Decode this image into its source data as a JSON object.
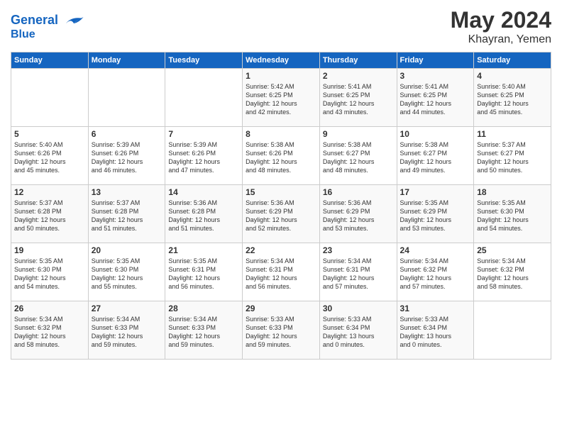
{
  "header": {
    "logo_line1": "General",
    "logo_line2": "Blue",
    "month": "May 2024",
    "location": "Khayran, Yemen"
  },
  "days_of_week": [
    "Sunday",
    "Monday",
    "Tuesday",
    "Wednesday",
    "Thursday",
    "Friday",
    "Saturday"
  ],
  "weeks": [
    [
      {
        "day": "",
        "info": ""
      },
      {
        "day": "",
        "info": ""
      },
      {
        "day": "",
        "info": ""
      },
      {
        "day": "1",
        "info": "Sunrise: 5:42 AM\nSunset: 6:25 PM\nDaylight: 12 hours\nand 42 minutes."
      },
      {
        "day": "2",
        "info": "Sunrise: 5:41 AM\nSunset: 6:25 PM\nDaylight: 12 hours\nand 43 minutes."
      },
      {
        "day": "3",
        "info": "Sunrise: 5:41 AM\nSunset: 6:25 PM\nDaylight: 12 hours\nand 44 minutes."
      },
      {
        "day": "4",
        "info": "Sunrise: 5:40 AM\nSunset: 6:25 PM\nDaylight: 12 hours\nand 45 minutes."
      }
    ],
    [
      {
        "day": "5",
        "info": "Sunrise: 5:40 AM\nSunset: 6:26 PM\nDaylight: 12 hours\nand 45 minutes."
      },
      {
        "day": "6",
        "info": "Sunrise: 5:39 AM\nSunset: 6:26 PM\nDaylight: 12 hours\nand 46 minutes."
      },
      {
        "day": "7",
        "info": "Sunrise: 5:39 AM\nSunset: 6:26 PM\nDaylight: 12 hours\nand 47 minutes."
      },
      {
        "day": "8",
        "info": "Sunrise: 5:38 AM\nSunset: 6:26 PM\nDaylight: 12 hours\nand 48 minutes."
      },
      {
        "day": "9",
        "info": "Sunrise: 5:38 AM\nSunset: 6:27 PM\nDaylight: 12 hours\nand 48 minutes."
      },
      {
        "day": "10",
        "info": "Sunrise: 5:38 AM\nSunset: 6:27 PM\nDaylight: 12 hours\nand 49 minutes."
      },
      {
        "day": "11",
        "info": "Sunrise: 5:37 AM\nSunset: 6:27 PM\nDaylight: 12 hours\nand 50 minutes."
      }
    ],
    [
      {
        "day": "12",
        "info": "Sunrise: 5:37 AM\nSunset: 6:28 PM\nDaylight: 12 hours\nand 50 minutes."
      },
      {
        "day": "13",
        "info": "Sunrise: 5:37 AM\nSunset: 6:28 PM\nDaylight: 12 hours\nand 51 minutes."
      },
      {
        "day": "14",
        "info": "Sunrise: 5:36 AM\nSunset: 6:28 PM\nDaylight: 12 hours\nand 51 minutes."
      },
      {
        "day": "15",
        "info": "Sunrise: 5:36 AM\nSunset: 6:29 PM\nDaylight: 12 hours\nand 52 minutes."
      },
      {
        "day": "16",
        "info": "Sunrise: 5:36 AM\nSunset: 6:29 PM\nDaylight: 12 hours\nand 53 minutes."
      },
      {
        "day": "17",
        "info": "Sunrise: 5:35 AM\nSunset: 6:29 PM\nDaylight: 12 hours\nand 53 minutes."
      },
      {
        "day": "18",
        "info": "Sunrise: 5:35 AM\nSunset: 6:30 PM\nDaylight: 12 hours\nand 54 minutes."
      }
    ],
    [
      {
        "day": "19",
        "info": "Sunrise: 5:35 AM\nSunset: 6:30 PM\nDaylight: 12 hours\nand 54 minutes."
      },
      {
        "day": "20",
        "info": "Sunrise: 5:35 AM\nSunset: 6:30 PM\nDaylight: 12 hours\nand 55 minutes."
      },
      {
        "day": "21",
        "info": "Sunrise: 5:35 AM\nSunset: 6:31 PM\nDaylight: 12 hours\nand 56 minutes."
      },
      {
        "day": "22",
        "info": "Sunrise: 5:34 AM\nSunset: 6:31 PM\nDaylight: 12 hours\nand 56 minutes."
      },
      {
        "day": "23",
        "info": "Sunrise: 5:34 AM\nSunset: 6:31 PM\nDaylight: 12 hours\nand 57 minutes."
      },
      {
        "day": "24",
        "info": "Sunrise: 5:34 AM\nSunset: 6:32 PM\nDaylight: 12 hours\nand 57 minutes."
      },
      {
        "day": "25",
        "info": "Sunrise: 5:34 AM\nSunset: 6:32 PM\nDaylight: 12 hours\nand 58 minutes."
      }
    ],
    [
      {
        "day": "26",
        "info": "Sunrise: 5:34 AM\nSunset: 6:32 PM\nDaylight: 12 hours\nand 58 minutes."
      },
      {
        "day": "27",
        "info": "Sunrise: 5:34 AM\nSunset: 6:33 PM\nDaylight: 12 hours\nand 59 minutes."
      },
      {
        "day": "28",
        "info": "Sunrise: 5:34 AM\nSunset: 6:33 PM\nDaylight: 12 hours\nand 59 minutes."
      },
      {
        "day": "29",
        "info": "Sunrise: 5:33 AM\nSunset: 6:33 PM\nDaylight: 12 hours\nand 59 minutes."
      },
      {
        "day": "30",
        "info": "Sunrise: 5:33 AM\nSunset: 6:34 PM\nDaylight: 13 hours\nand 0 minutes."
      },
      {
        "day": "31",
        "info": "Sunrise: 5:33 AM\nSunset: 6:34 PM\nDaylight: 13 hours\nand 0 minutes."
      },
      {
        "day": "",
        "info": ""
      }
    ]
  ]
}
